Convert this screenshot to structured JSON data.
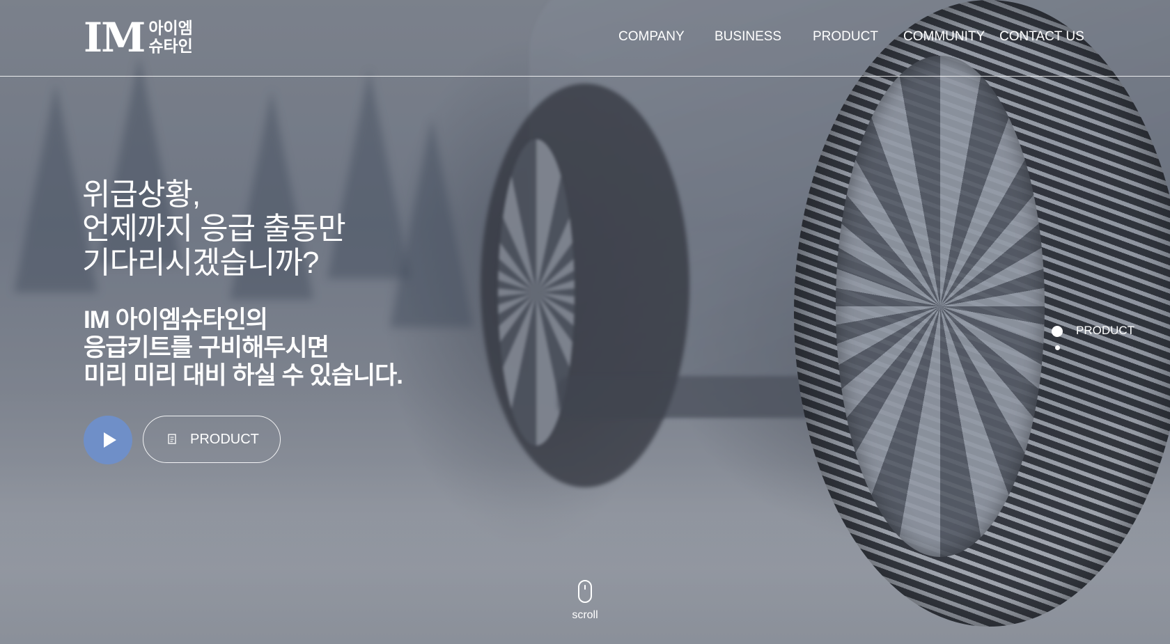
{
  "header": {
    "logo": {
      "mark": "IM",
      "text_line1": "아이엠",
      "text_line2": "슈타인"
    },
    "nav": [
      {
        "label": "COMPANY"
      },
      {
        "label": "BUSINESS"
      },
      {
        "label": "PRODUCT"
      },
      {
        "label": "COMMUNITY"
      },
      {
        "label": "CONTACT US"
      }
    ]
  },
  "hero": {
    "headline": [
      "위급상황,",
      "언제까지 응급 출동만",
      "기다리시겠습니까?"
    ],
    "subline": [
      "IM 아이엠슈타인의",
      "응급키트를 구비해두시면",
      "미리 미리 대비 하실 수 있습니다."
    ],
    "play_button_icon": "play-icon",
    "product_button": {
      "icon": "document-icon",
      "label": "PRODUCT"
    }
  },
  "pager": {
    "active_label": "PRODUCT"
  },
  "scroll": {
    "icon": "mouse-icon",
    "label": "scroll"
  },
  "colors": {
    "accent": "#6f8fc8",
    "text": "#ffffff"
  }
}
